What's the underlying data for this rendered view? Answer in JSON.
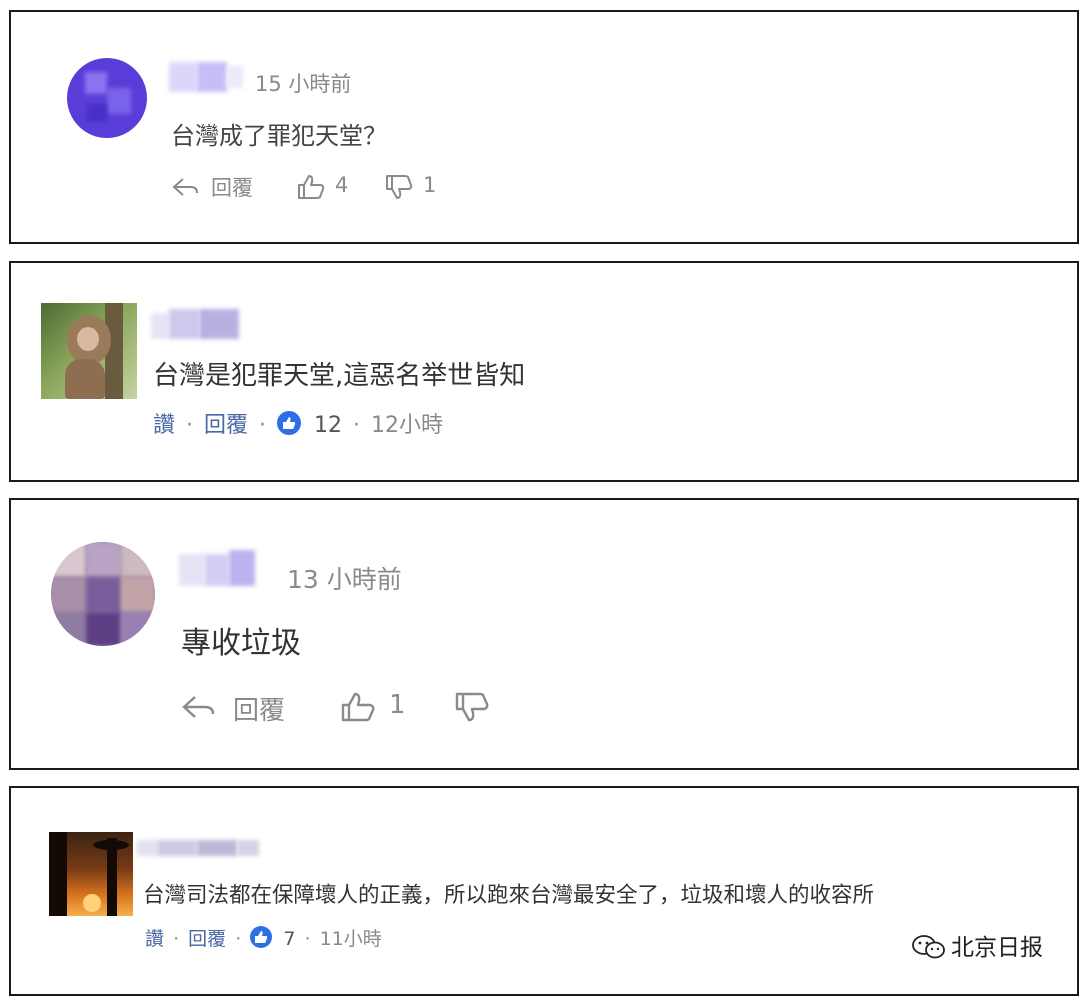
{
  "comments": [
    {
      "time": "15 小時前",
      "text": "台灣成了罪犯天堂？",
      "reply": "回覆",
      "likes": "4",
      "dislikes": "1"
    },
    {
      "text": "台灣是犯罪天堂,這惡名举世皆知",
      "like": "讚",
      "reply": "回覆",
      "sep": "·",
      "reactions": "12",
      "time": "12小時"
    },
    {
      "time": "13 小時前",
      "text": "專收垃圾",
      "reply": "回覆",
      "likes": "1"
    },
    {
      "text": "台灣司法都在保障壞人的正義，所以跑來台灣最安全了，垃圾和壞人的收容所",
      "like": "讚",
      "reply": "回覆",
      "sep": "·",
      "reactions": "7",
      "time": "11小時"
    }
  ],
  "watermark": "北京日报",
  "colors": {
    "avatar_purple": "#5a3dd8",
    "like_blue": "#2f6fe6",
    "link_blue": "#4b67a5"
  }
}
